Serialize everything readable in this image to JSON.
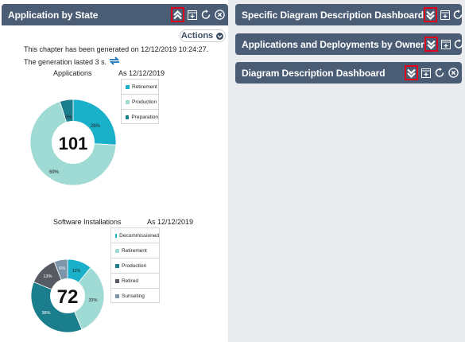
{
  "left_panel": {
    "title": "Application by State",
    "actions_label": "Actions",
    "generated_text": "This chapter has been generated on 12/12/2019 10:24:27.",
    "duration_text": "The generation lasted 3 s.",
    "chart1": {
      "title": "Applications",
      "date": "As 12/12/2019",
      "total": "101",
      "legend": [
        "Retirement",
        "Production",
        "Preparation"
      ],
      "labels": [
        "26%",
        "69%",
        "5%"
      ]
    },
    "chart2": {
      "title": "Software Installations",
      "date": "As 12/12/2019",
      "total": "72",
      "legend": [
        "Decommissioned",
        "Retirement",
        "Production",
        "Retired",
        "Sunseting"
      ],
      "labels": [
        "11%",
        "33%",
        "38%",
        "13%",
        "6%"
      ]
    }
  },
  "right_panels": [
    {
      "title": "Specific Diagram Description Dashboard"
    },
    {
      "title": "Applications and Deployments by Owner"
    },
    {
      "title": "Diagram Description Dashboard"
    }
  ],
  "colors": {
    "header_bg": "#4a5d74",
    "highlight": "#e0001b",
    "teal": "#1bb0c9",
    "light_teal": "#9fdad4",
    "dark_teal": "#1a7e8d",
    "dark_gray": "#555a63",
    "blue_gray": "#7d95a8"
  },
  "chart_data": [
    {
      "type": "pie",
      "title": "Applications",
      "subtitle": "As 12/12/2019",
      "center_label": "101",
      "categories": [
        "Retirement",
        "Production",
        "Preparation"
      ],
      "values": [
        26,
        69,
        5
      ],
      "colors": [
        "#1bb0c9",
        "#9fdad4",
        "#1a7e8d"
      ],
      "legend": "right"
    },
    {
      "type": "pie",
      "title": "Software Installations",
      "subtitle": "As 12/12/2019",
      "center_label": "72",
      "categories": [
        "Decommissioned",
        "Retirement",
        "Production",
        "Retired",
        "Sunseting"
      ],
      "values": [
        11,
        33,
        38,
        13,
        6
      ],
      "colors": [
        "#1bb0c9",
        "#9fdad4",
        "#1a7e8d",
        "#555a63",
        "#7d95a8"
      ],
      "legend": "right"
    }
  ]
}
